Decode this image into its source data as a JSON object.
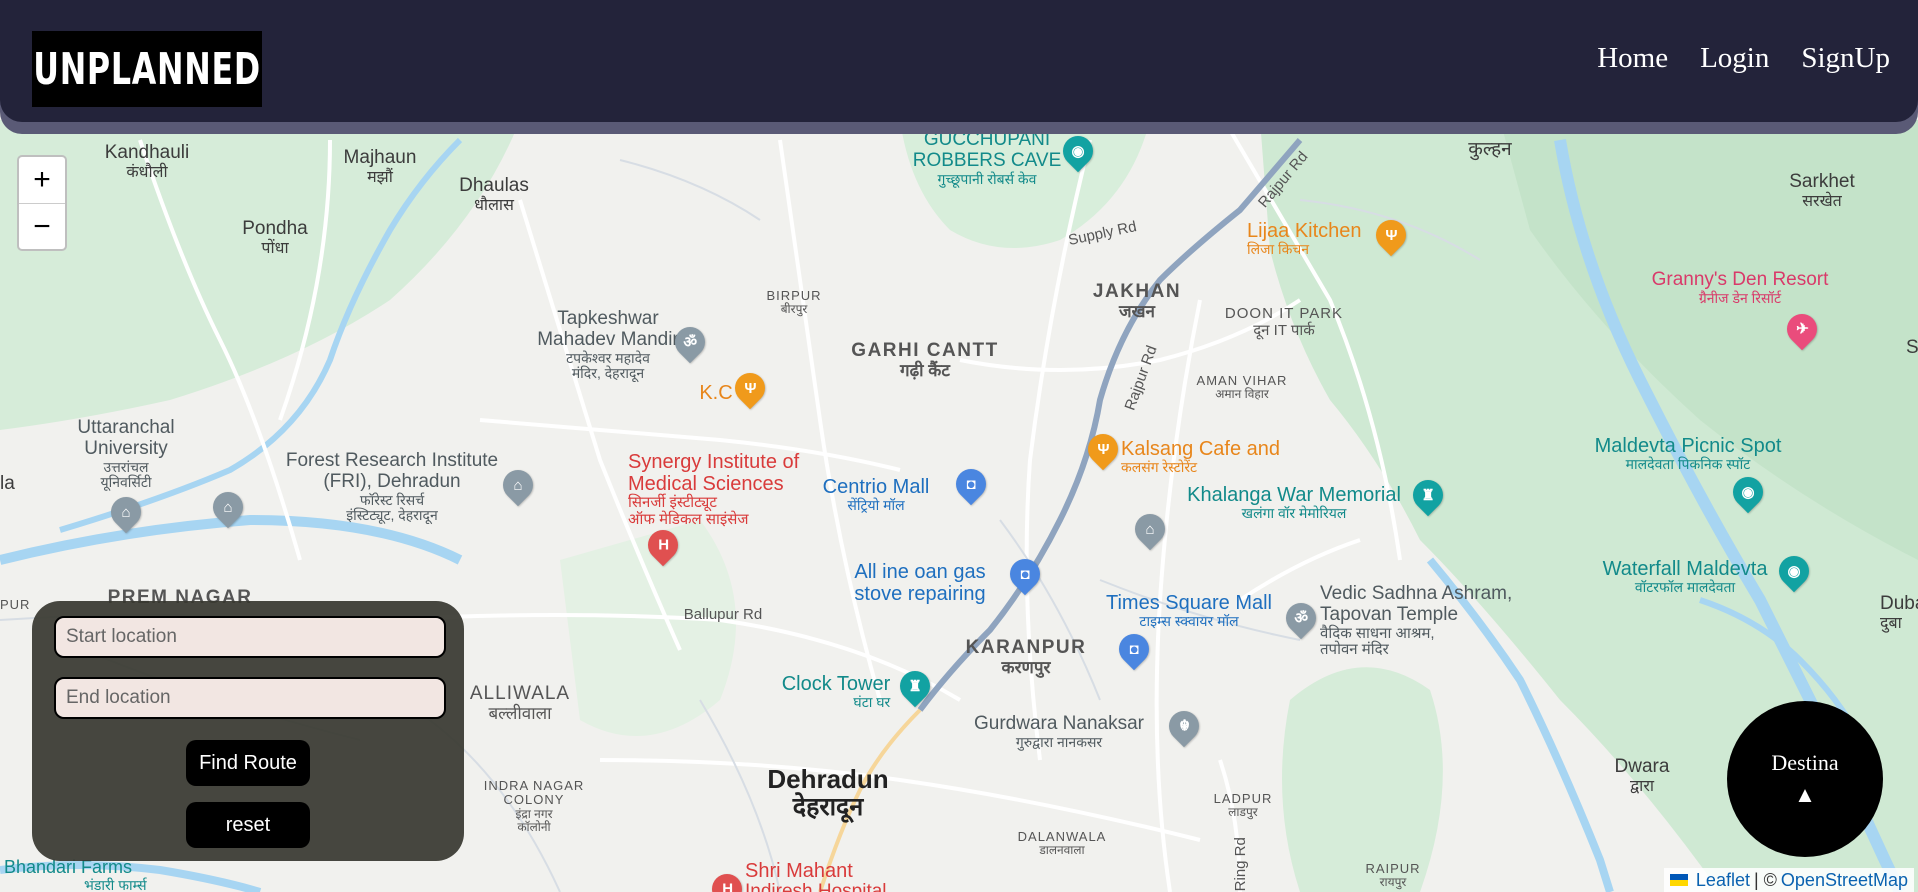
{
  "header": {
    "logo_text": "UNPLANNED",
    "nav": [
      {
        "label": "Home"
      },
      {
        "label": "Login"
      },
      {
        "label": "SignUp"
      }
    ]
  },
  "zoom": {
    "in_label": "+",
    "out_label": "−"
  },
  "route_panel": {
    "start_placeholder": "Start location",
    "end_placeholder": "End location",
    "find_button": "Find Route",
    "reset_button": "reset"
  },
  "destination_button": {
    "label": "Destina",
    "arrow": "▲"
  },
  "attribution": {
    "leaflet": "Leaflet",
    "separator": "| ©",
    "osm": "OpenStreetMap"
  },
  "map_labels": {
    "kandhauli": {
      "en": "Kandhauli",
      "hi": "कंधौली"
    },
    "majhaun": {
      "en": "Majhaun",
      "hi": "मझौं"
    },
    "dhaulas": {
      "en": "Dhaulas",
      "hi": "धौलास"
    },
    "pondha": {
      "en": "Pondha",
      "hi": "पोंधा"
    },
    "robbers_cave": {
      "en": "GUCCHUPANI\nROBBERS CAVE",
      "hi": "गुच्छूपानी रोबर्स केव"
    },
    "kulhan": {
      "en": "कुल्हन"
    },
    "sarkhet": {
      "en": "Sarkhet",
      "hi": "सरखेत"
    },
    "grannys": {
      "en": "Granny's Den Resort",
      "hi": "ग्रैनीज डेन रिसॉर्ट"
    },
    "lijaa": {
      "en": "Lijaa Kitchen",
      "hi": "लिजा किचन"
    },
    "jakhan": {
      "en": "JAKHAN",
      "hi": "जखन"
    },
    "doon_it": {
      "en": "DOON IT PARK",
      "hi": "दून IT पार्क"
    },
    "birpur": {
      "en": "BIRPUR",
      "hi": "बीरपुर"
    },
    "garhi": {
      "en": "GARHI CANTT",
      "hi": "गढ़ी कैंट"
    },
    "tapkeshwar": {
      "en": "Tapkeshwar\nMahadev Mandir",
      "hi": "टपकेश्वर महादेव\nमंदिर, देहरादून"
    },
    "kc": {
      "en": "K.C"
    },
    "aman_vihar": {
      "en": "AMAN VIHAR",
      "hi": "अमान विहार"
    },
    "uttaranchal": {
      "en": "Uttaranchal\nUniversity",
      "hi": "उत्तरांचल\nयूनिवर्सिटी"
    },
    "fri": {
      "en": "Forest Research Institute\n(FRI), Dehradun",
      "hi": "फॉरेस्ट रिसर्च\nइंस्टिट्यूट, देहरादून"
    },
    "synergy": {
      "en": "Synergy Institute of\nMedical Sciences",
      "hi": "सिनर्जी इंस्टीट्यूट\nऑफ मेडिकल साइंसेज"
    },
    "centrio": {
      "en": "Centrio Mall",
      "hi": "सेंट्रियो मॉल"
    },
    "kalsang": {
      "en": "Kalsang Cafe and",
      "hi": "कलसंग रेस्टोरेंट"
    },
    "maldevta_picnic": {
      "en": "Maldevta Picnic Spot",
      "hi": "मालदेवता पिकनिक स्पॉट"
    },
    "khalanga": {
      "en": "Khalanga War Memorial",
      "hi": "खलंगा वॉर मेमोरियल"
    },
    "allinone": {
      "en": "All ine oan gas\nstove repairing"
    },
    "times_square": {
      "en": "Times Square Mall",
      "hi": "टाइम्स स्क्वायर मॉल"
    },
    "vedic": {
      "en": "Vedic Sadhna Ashram,\nTapovan Temple",
      "hi": "वैदिक साधना आश्रम,\nतपोवन मंदिर"
    },
    "waterfall": {
      "en": "Waterfall Maldevta",
      "hi": "वॉटरफॉल मालदेवता"
    },
    "dubada": {
      "en": "Duba",
      "hi": "दुबा"
    },
    "prem_nagar": {
      "en": "PREM NAGAR"
    },
    "balliwala": {
      "en": "ALLIWALA",
      "hi": "बल्लीवाला"
    },
    "ballupur_rd": {
      "en": "Ballupur Rd"
    },
    "karanpur": {
      "en": "KARANPUR",
      "hi": "करणपुर"
    },
    "clock_tower": {
      "en": "Clock Tower",
      "hi": "घंटा घर"
    },
    "gurdwara": {
      "en": "Gurdwara Nanaksar",
      "hi": "गुरुद्वारा नानकसर"
    },
    "dwara": {
      "en": "Dwara",
      "hi": "द्वारा"
    },
    "indra_nagar": {
      "en": "INDRA NAGAR\nCOLONY",
      "hi": "इंद्रा नगर\nकॉलोनी"
    },
    "dehradun": {
      "en": "Dehradun",
      "hi": "देहरादून"
    },
    "ladpur": {
      "en": "LADPUR",
      "hi": "लाडपुर"
    },
    "dalanwala": {
      "en": "DALANWALA",
      "hi": "डालनवाला"
    },
    "raipur": {
      "en": "RAIPUR",
      "hi": "रायपुर"
    },
    "bhandari": {
      "en": "Bhandari Farms",
      "hi": "भंडारी फार्म्स"
    },
    "shri_mahant": {
      "en": "Shri Mahant",
      "hi": "Indiresh Hospital"
    },
    "supply_rd": {
      "en": "Supply Rd"
    },
    "rajpur_rd_1": {
      "en": "Rajpur Rd"
    },
    "rajpur_rd_2": {
      "en": "Rajpur Rd"
    },
    "ring_rd": {
      "en": "Ring Rd"
    },
    "shi": {
      "en": "Shi"
    },
    "la": {
      "en": "la"
    },
    "pur": {
      "en": "PUR"
    }
  }
}
